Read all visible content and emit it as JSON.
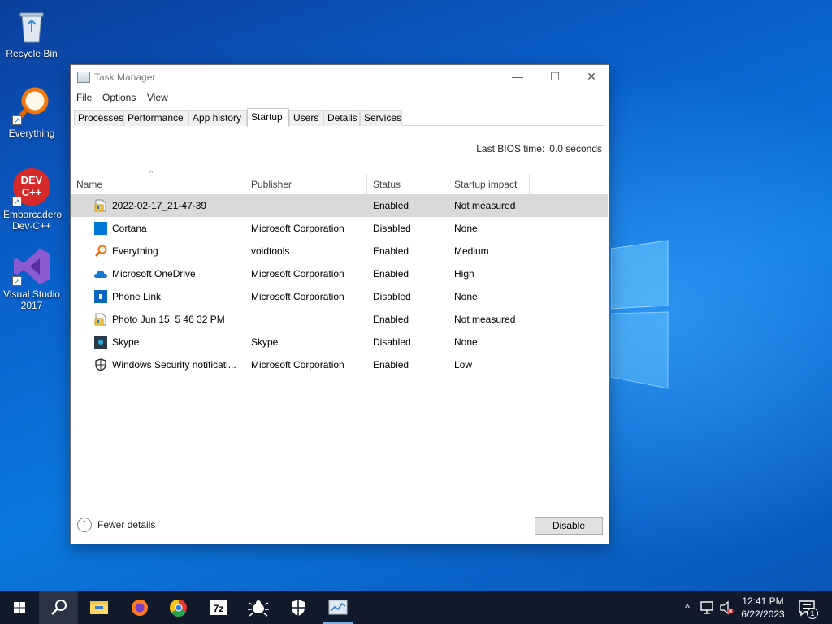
{
  "desktop": {
    "icons": [
      {
        "label": "Recycle Bin"
      },
      {
        "label": "Everything"
      },
      {
        "label": "Embarcadero Dev-C++",
        "logo_text": "DEV C++"
      },
      {
        "label": "Visual Studio 2017"
      }
    ]
  },
  "window": {
    "title": "Task Manager",
    "minimize_glyph": "—",
    "maximize_glyph": "☐",
    "close_glyph": "✕"
  },
  "menu": [
    "File",
    "Options",
    "View"
  ],
  "tabs": [
    "Processes",
    "Performance",
    "App history",
    "Startup",
    "Users",
    "Details",
    "Services"
  ],
  "active_tab": "Startup",
  "bios": {
    "label": "Last BIOS time:",
    "value": "0.0 seconds"
  },
  "table": {
    "columns": [
      "Name",
      "Publisher",
      "Status",
      "Startup impact"
    ],
    "sort_indicator": "^",
    "rows": [
      {
        "name": "2022-02-17_21-47-39",
        "publisher": "",
        "status": "Enabled",
        "impact": "Not measured",
        "icon": "file-folder-icon",
        "selected": true
      },
      {
        "name": "Cortana",
        "publisher": "Microsoft Corporation",
        "status": "Disabled",
        "impact": "None",
        "icon": "cortana-icon"
      },
      {
        "name": "Everything",
        "publisher": "voidtools",
        "status": "Enabled",
        "impact": "Medium",
        "icon": "magnifier-icon"
      },
      {
        "name": "Microsoft OneDrive",
        "publisher": "Microsoft Corporation",
        "status": "Enabled",
        "impact": "High",
        "icon": "cloud-icon"
      },
      {
        "name": "Phone Link",
        "publisher": "Microsoft Corporation",
        "status": "Disabled",
        "impact": "None",
        "icon": "phone-link-icon"
      },
      {
        "name": "Photo Jun 15, 5 46 32 PM",
        "publisher": "",
        "status": "Enabled",
        "impact": "Not measured",
        "icon": "file-folder-icon"
      },
      {
        "name": "Skype",
        "publisher": "Skype",
        "status": "Disabled",
        "impact": "None",
        "icon": "skype-icon"
      },
      {
        "name": "Windows Security notificati...",
        "publisher": "Microsoft Corporation",
        "status": "Enabled",
        "impact": "Low",
        "icon": "shield-icon"
      }
    ]
  },
  "footer": {
    "fewer_details": "Fewer details",
    "fewer_glyph": "⌃",
    "disable_button": "Disable"
  },
  "taskbar": {
    "apps": [
      "start-icon",
      "search-icon",
      "file-explorer-icon",
      "firefox-icon",
      "chrome-icon",
      "7zip-icon",
      "bug-tool-icon",
      "shield-icon",
      "task-manager-icon"
    ],
    "sevenzip_text": "7z",
    "tray_chevron": "^",
    "time": "12:41 PM",
    "date": "6/22/2023",
    "notification_count": "1"
  },
  "colors": {
    "accent": "#0078d7",
    "selected_row": "#d9d9d9",
    "taskbar": "#101a2b"
  }
}
